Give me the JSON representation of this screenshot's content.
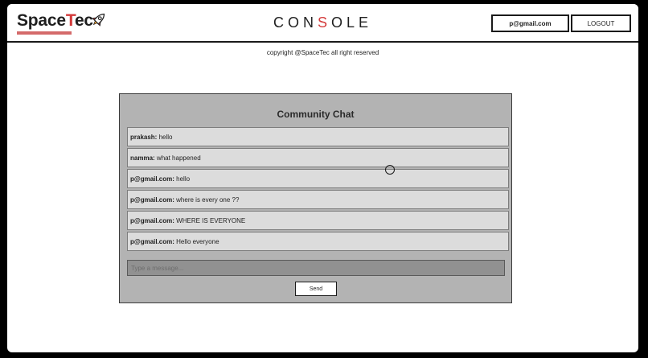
{
  "header": {
    "logo_text_part1": "Space",
    "logo_text_accent": "T",
    "logo_text_part2": "ec",
    "rocket_icon": "rocket-icon",
    "title_part1": "CON",
    "title_accent": "S",
    "title_part2": "OLE",
    "user_email": "p@gmail.com",
    "logout_label": "LOGOUT"
  },
  "copyright": "copyright @SpaceTec all right reserved",
  "chat": {
    "title": "Community Chat",
    "messages": [
      {
        "author": "prakash:",
        "text": "hello"
      },
      {
        "author": "namma:",
        "text": "what happened"
      },
      {
        "author": "p@gmail.com:",
        "text": "hello"
      },
      {
        "author": "p@gmail.com:",
        "text": "where is every one ??"
      },
      {
        "author": "p@gmail.com:",
        "text": "WHERE IS EVERYONE"
      },
      {
        "author": "p@gmail.com:",
        "text": "Hello everyone"
      }
    ],
    "input_placeholder": "Type a message...",
    "input_value": "",
    "send_label": "Send"
  },
  "colors": {
    "accent": "#d43b3b",
    "panel_bg": "#b3b3b3",
    "message_bg": "#dcdcdc",
    "input_bg": "#919191"
  }
}
